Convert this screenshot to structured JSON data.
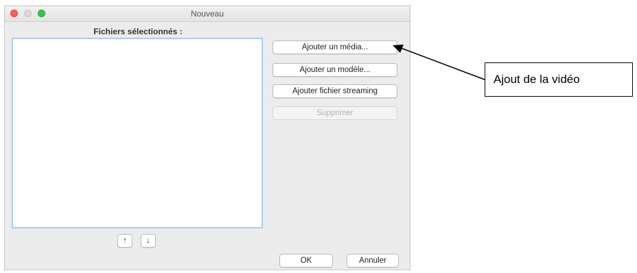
{
  "window": {
    "title": "Nouveau"
  },
  "files": {
    "label": "Fichiers sélectionnés :"
  },
  "buttons": {
    "add_media": "Ajouter un média...",
    "add_model": "Ajouter un modèle...",
    "add_streaming": "Ajouter fichier streaming",
    "delete": "Supprimer",
    "move_up": "↑",
    "move_down": "↓",
    "ok": "OK",
    "cancel": "Annuler"
  },
  "annotation": {
    "text": "Ajout de la vidéo"
  }
}
